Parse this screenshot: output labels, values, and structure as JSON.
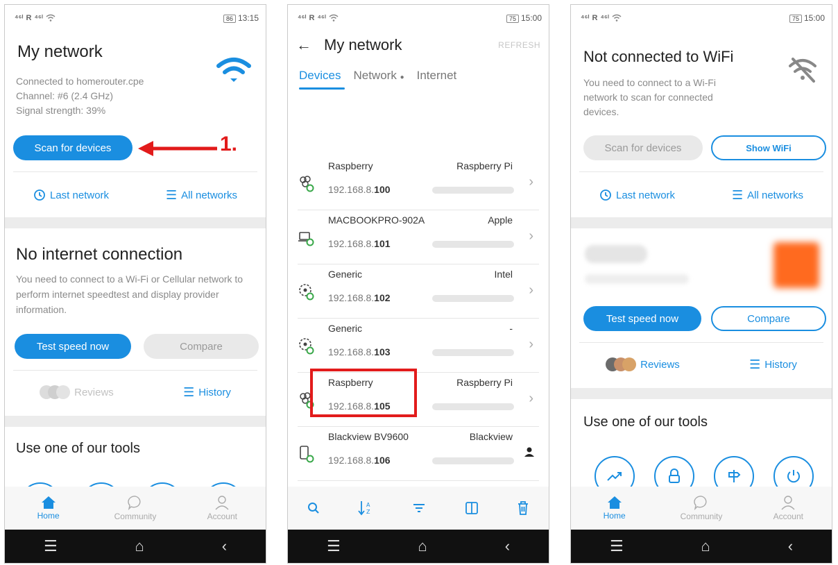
{
  "status": {
    "p1_time": "13:15",
    "p1_battery": "86",
    "p2_time": "15:00",
    "p2_battery": "75",
    "p3_time": "15:00",
    "p3_battery": "75",
    "carrier": "R"
  },
  "screen1": {
    "title": "My network",
    "connected": "Connected to homerouter.cpe",
    "channel": "Channel: #6 (2.4 GHz)",
    "signal": "Signal strength: 39%",
    "scan_button": "Scan for devices",
    "annotation": "1.",
    "last_network": "Last network",
    "all_networks": "All networks",
    "no_internet_title": "No internet connection",
    "no_internet_text": "You need to connect to a Wi-Fi or Cellular network to perform internet speedtest and display provider information.",
    "test_speed": "Test speed now",
    "compare": "Compare",
    "reviews": "Reviews",
    "history": "History",
    "tools_title": "Use one of our tools"
  },
  "screen2": {
    "title": "My network",
    "refresh": "REFRESH",
    "tabs": [
      "Devices",
      "Network",
      "Internet"
    ],
    "devices": [
      {
        "name": "Raspberry",
        "vendor": "Raspberry Pi",
        "ip_prefix": "192.168.8.",
        "ip_suffix": "100",
        "icon": "raspberry-icon"
      },
      {
        "name": "MACBOOKPRO-902A",
        "vendor": "Apple",
        "ip_prefix": "192.168.8.",
        "ip_suffix": "101",
        "icon": "laptop-icon"
      },
      {
        "name": "Generic",
        "vendor": "Intel",
        "ip_prefix": "192.168.8.",
        "ip_suffix": "102",
        "icon": "generic-device-icon"
      },
      {
        "name": "Generic",
        "vendor": "-",
        "ip_prefix": "192.168.8.",
        "ip_suffix": "103",
        "icon": "generic-device-icon"
      },
      {
        "name": "Raspberry",
        "vendor": "Raspberry Pi",
        "ip_prefix": "192.168.8.",
        "ip_suffix": "105",
        "icon": "raspberry-icon"
      },
      {
        "name": "Blackview BV9600",
        "vendor": "Blackview",
        "ip_prefix": "192.168.8.",
        "ip_suffix": "106",
        "icon": "phone-icon"
      }
    ]
  },
  "screen3": {
    "title": "Not connected to WiFi",
    "text": "You need to connect to a Wi-Fi network to scan for connected devices.",
    "scan_button": "Scan for devices",
    "show_wifi": "Show WiFi",
    "last_network": "Last network",
    "all_networks": "All networks",
    "test_speed": "Test speed now",
    "compare": "Compare",
    "reviews": "Reviews",
    "history": "History",
    "tools_title": "Use one of our tools"
  },
  "nav": {
    "home": "Home",
    "community": "Community",
    "account": "Account"
  },
  "colors": {
    "accent": "#1a8ee0",
    "annotation": "#e21b1b"
  }
}
